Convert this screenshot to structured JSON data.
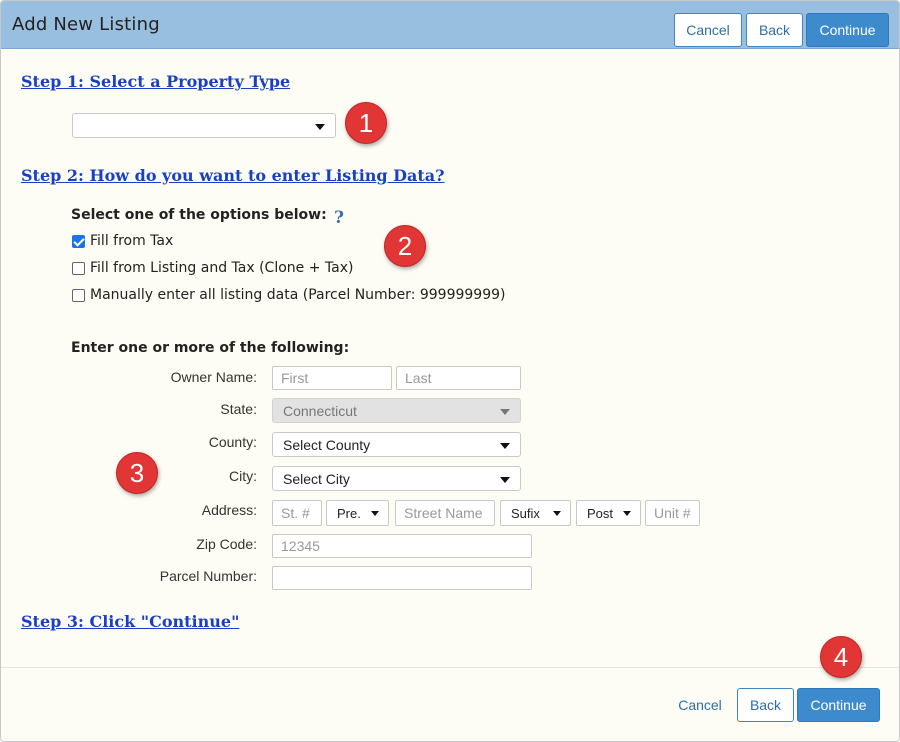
{
  "dialog": {
    "title": "Add New Listing",
    "header_buttons": {
      "cancel": "Cancel",
      "back": "Back",
      "continue": "Continue"
    },
    "footer_buttons": {
      "cancel": "Cancel",
      "back": "Back",
      "continue": "Continue"
    }
  },
  "steps": {
    "step1": "Step 1: Select a Property Type",
    "step2": "Step 2: How do you want to enter Listing Data?",
    "step3": "Step 3: Click \"Continue\""
  },
  "property_type": {
    "selected": ""
  },
  "options": {
    "heading": "Select one of the options below:",
    "help_icon": "?",
    "items": [
      {
        "label": "Fill from Tax",
        "checked": true
      },
      {
        "label": "Fill from Listing and Tax (Clone + Tax)",
        "checked": false
      },
      {
        "label": "Manually enter all listing data (Parcel Number: 999999999)",
        "checked": false
      }
    ]
  },
  "form": {
    "heading": "Enter one or more of the following:",
    "owner_label": "Owner Name:",
    "first_placeholder": "First",
    "last_placeholder": "Last",
    "state_label": "State:",
    "state_value": "Connecticut",
    "county_label": "County:",
    "county_value": "Select County",
    "city_label": "City:",
    "city_value": "Select City",
    "address_label": "Address:",
    "street_num_placeholder": "St. #",
    "prefix_value": "Pre.",
    "street_name_placeholder": "Street Name",
    "suffix_value": "Sufix",
    "post_value": "Post",
    "unit_placeholder": "Unit #",
    "zip_label": "Zip Code:",
    "zip_placeholder": "12345",
    "parcel_label": "Parcel Number:",
    "parcel_value": ""
  },
  "badges": [
    "1",
    "2",
    "3",
    "4"
  ],
  "colors": {
    "header": "#99bfe0",
    "primary": "#3d8bcd",
    "step_link": "#1a3fc4",
    "badge": "#e23535"
  }
}
